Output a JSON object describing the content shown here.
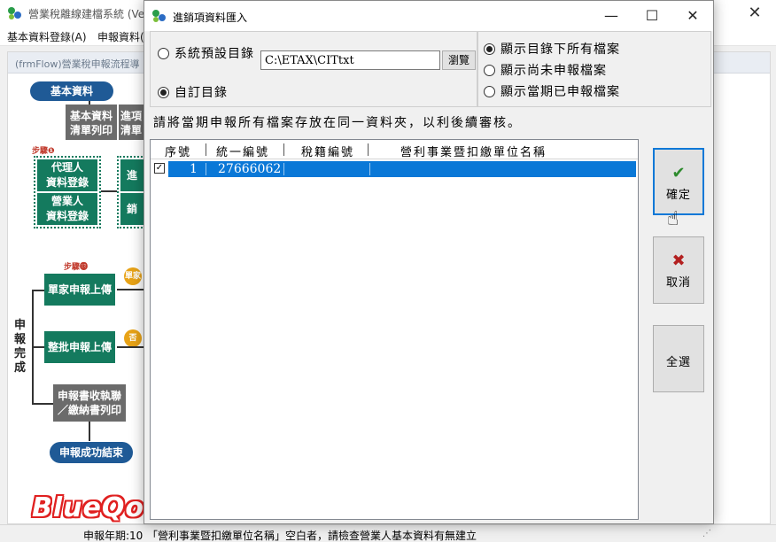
{
  "colors": {
    "selection": "#0a78d7",
    "confirm_check": "#2e8b2e",
    "cancel_x": "#b32020",
    "flow_green": "#147a5e",
    "flow_blue": "#1f5a96"
  },
  "main_window": {
    "title": "營業稅離線建檔系統 (Ver",
    "close_icon": "close-icon",
    "menu": [
      "基本資料登錄(A)",
      "申報資料("
    ],
    "content_title": "(frmFlow)營業稅申報流程導",
    "flow": {
      "basic_data": "基本資料",
      "list_print": [
        "基本資料",
        "清單列印"
      ],
      "import_list": [
        "進項",
        "清單"
      ],
      "step1": "步驟❶",
      "agent": [
        "代理人",
        "資料登錄"
      ],
      "business": [
        "營業人",
        "資料登錄"
      ],
      "purchase": "進",
      "sales": "銷",
      "step13": "步驟⓭",
      "single_upload": "單家申報上傳",
      "single_badge": "單家",
      "batch_upload": "整批申報上傳",
      "batch_badge": "否",
      "receipt_print": [
        "申報書收執聯",
        "／繳納書列印"
      ],
      "complete_vertical": [
        "申",
        "報",
        "完",
        "成"
      ],
      "success_end": "申報成功結束"
    },
    "watermark": "BlueQoo",
    "status_period": "申報年期:10",
    "status_message": "「營利事業暨扣繳單位名稱」空白者，請檢查營業人基本資料有無建立"
  },
  "dialog": {
    "title": "進銷項資料匯入",
    "minimize_icon": "minimize-icon",
    "maximize_icon": "maximize-icon",
    "close_icon": "close-icon",
    "dir_options": [
      "系統預設目錄",
      "自訂目錄"
    ],
    "dir_selected": 1,
    "path_value": "C:\\ETAX\\CITtxt",
    "browse_label": "瀏覽",
    "filter_options": [
      "顯示目錄下所有檔案",
      "顯示尚未申報檔案",
      "顯示當期已申報檔案"
    ],
    "filter_selected": 0,
    "instruction": "請將當期申報所有檔案存放在同一資料夾，以利後續審核。",
    "grid": {
      "columns": [
        "序號",
        "統一編號",
        "稅籍編號",
        "營利事業暨扣繳單位名稱"
      ],
      "rows": [
        {
          "checked": true,
          "seq": "1",
          "uniform_no": "27666062",
          "tax_no": "",
          "name": ""
        }
      ]
    },
    "confirm_label": "確定",
    "confirm_icon": "check-icon",
    "cancel_label": "取消",
    "cancel_icon": "x-icon",
    "select_all_label": "全選",
    "cursor_icon": "hand-pointer-icon"
  }
}
